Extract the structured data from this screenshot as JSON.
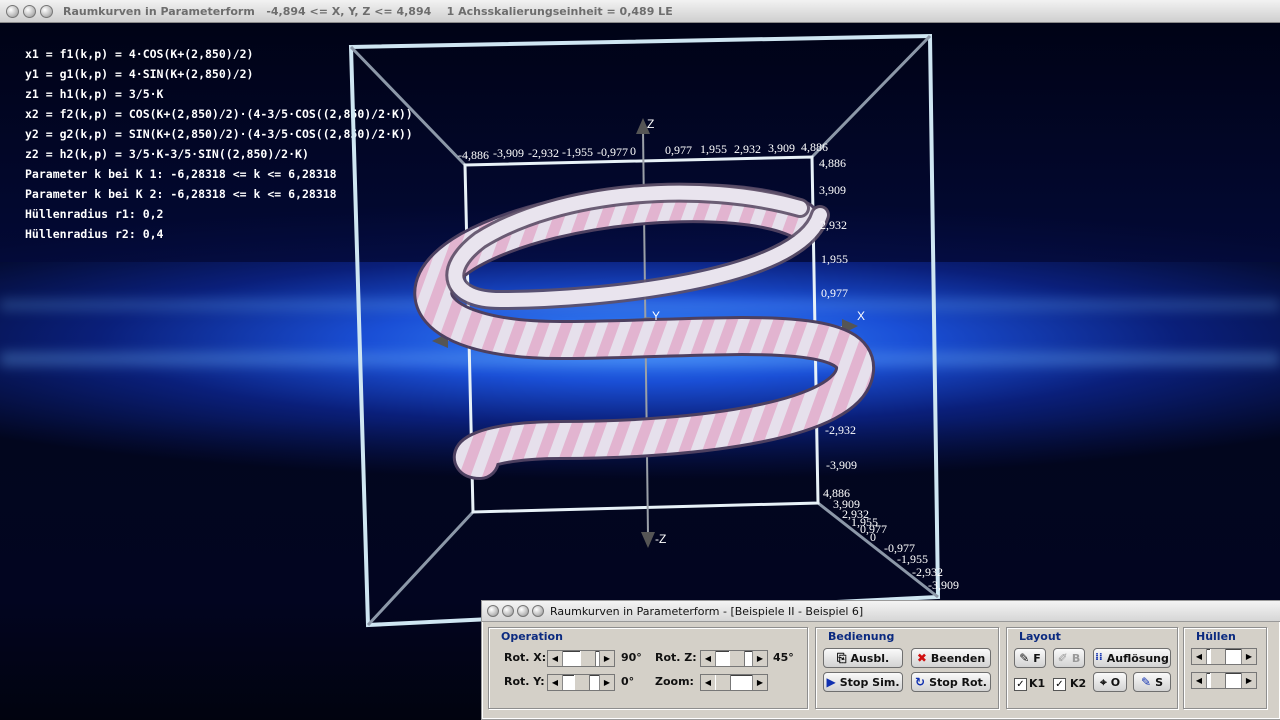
{
  "window": {
    "title": "Raumkurven in Parameterform",
    "range": "-4,894 <= X, Y, Z <= 4,894",
    "scale": "1 Achsskalierungseinheit = 0,489 LE"
  },
  "formulas": [
    "x1 = f1(k,p) = 4·COS(K+(2,850)/2)",
    "y1 = g1(k,p) = 4·SIN(K+(2,850)/2)",
    "z1 = h1(k,p) = 3/5·K",
    "x2 = f2(k,p) = COS(K+(2,850)/2)·(4-3/5·COS((2,850)/2·K))",
    "y2 = g2(k,p) = SIN(K+(2,850)/2)·(4-3/5·COS((2,850)/2·K))",
    "z2 = h2(k,p) = 3/5·K-3/5·SIN((2,850)/2·K)",
    "Parameter k bei K 1: -6,28318 <= k <= 6,28318",
    "Parameter k bei K 2: -6,28318 <= k <= 6,28318",
    "Hüllenradius r1: 0,2",
    "Hüllenradius r2: 0,4"
  ],
  "axes": {
    "z_label": "Z",
    "neg_z_label": "-Z",
    "x_label": "X",
    "y_label": "Y",
    "top_labels": [
      "-4,886",
      "-3,909",
      "-2,932",
      "-1,955",
      "-0,977",
      "0",
      "0,977",
      "1,955",
      "2,932",
      "3,909",
      "4,886"
    ],
    "right_labels": [
      "4,886",
      "3,909",
      "2,932",
      "1,955",
      "0,977",
      "-2,932",
      "-3,909"
    ],
    "depth_labels": [
      "4,886",
      "3,909",
      "2,932",
      "1,955",
      "0,977",
      "0",
      "-0,977",
      "-1,955",
      "-2,932",
      "-3,909"
    ]
  },
  "panel": {
    "title": "Raumkurven in Parameterform - [Beispiele II - Beispiel 6]",
    "operation": {
      "title": "Operation",
      "rot_x_label": "Rot. X:",
      "rot_x_value": "90°",
      "rot_y_label": "Rot. Y:",
      "rot_y_value": "0°",
      "rot_z_label": "Rot. Z:",
      "rot_z_value": "45°",
      "zoom_label": "Zoom:"
    },
    "bedienung": {
      "title": "Bedienung",
      "ausbl": "Ausbl.",
      "beenden": "Beenden",
      "stop_sim": "Stop Sim.",
      "stop_rot": "Stop Rot."
    },
    "layout": {
      "title": "Layout",
      "f_btn": "F",
      "b_btn": "B",
      "aufloesung": "Auflösung",
      "o_btn": "O",
      "s_btn": "S",
      "k1": "K1",
      "k2": "K2",
      "k1_checked": true,
      "k2_checked": true
    },
    "huellen": {
      "title": "Hüllen"
    }
  }
}
